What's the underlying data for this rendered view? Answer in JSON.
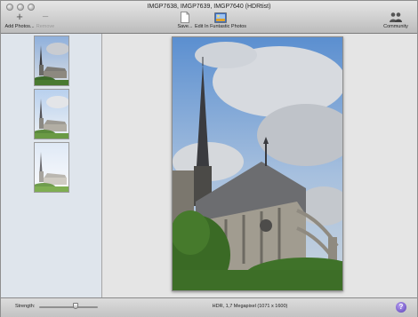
{
  "window": {
    "title": "IMGP7638, IMGP7639, IMGP7640 (HDRtist)"
  },
  "toolbar": {
    "add_photos_label": "Add Photos...",
    "remove_label": "Remove",
    "save_label": "Save...",
    "edit_label": "Edit In Funtastic Photos",
    "community_label": "Community",
    "icons": {
      "add": "plus-icon",
      "remove": "minus-icon",
      "save": "document-icon",
      "edit": "photo-editor-icon",
      "community": "people-icon"
    }
  },
  "sidebar": {
    "thumbnails": [
      {
        "name": "IMGP7638"
      },
      {
        "name": "IMGP7639"
      },
      {
        "name": "IMGP7640"
      }
    ]
  },
  "status": {
    "strength_label": "Strength:",
    "strength_value": 0.62,
    "info": "HDR, 1,7 Megapixel (1071 x 1600)",
    "help_label": "?"
  },
  "colors": {
    "sidebar_bg": "#dfe5ec",
    "help_button": "#5a3db8"
  }
}
